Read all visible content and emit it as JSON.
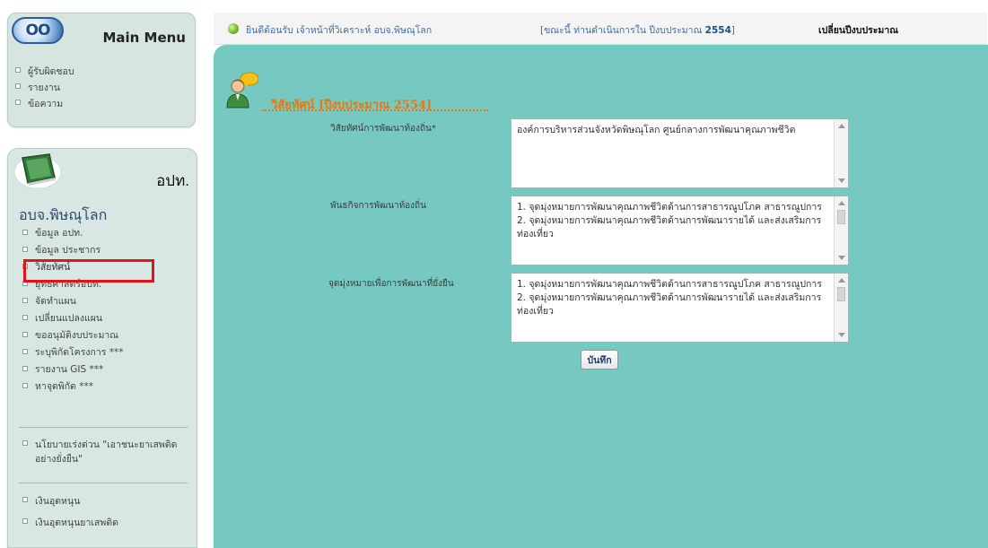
{
  "main_menu": {
    "logo_text": "OO",
    "title": "Main Menu",
    "items": [
      "ผู้รับผิดชอบ",
      "รายงาน",
      "ข้อความ"
    ]
  },
  "org": {
    "abbr": "อปท.",
    "name": "อบจ.พิษณุโลก",
    "items": [
      "ข้อมูล อปท.",
      "ข้อมูล ประชากร",
      "วิสัยทัศน์",
      "ยุทธศาสตร์อปท.",
      "จัดทำแผน",
      "เปลี่ยนแปลงแผน",
      "ขออนุมัติงบประมาณ",
      "ระบุพิกัดโครงการ ***",
      "รายงาน GIS ***",
      "หาจุดพิกัด ***"
    ],
    "active_item": "วิสัยทัศน์",
    "policy_item": "นโยบายเร่งด่วน \"เอาชนะยาเสพติดอย่างยั่งยืน\"",
    "fund_items": [
      "เงินอุดหนุน",
      "เงินอุดหนุนยาเสพติด"
    ]
  },
  "top_bar": {
    "welcome": "ยินดีต้อนรับ เจ้าหน้าที่วิเคราะห์ อบจ.พิษณุโลก",
    "year_status_prefix": "[ขณะนี้ ท่านดำเนินการใน ปีงบประมาณ",
    "year": "2554",
    "year_status_suffix": "]",
    "change_year_link": "เปลี่ยนปีงบประมาณ"
  },
  "page": {
    "title": "วิสัยทัศน์ [ปีงบประมาณ 2554]",
    "fields": [
      {
        "label": "วิสัยทัศน์การพัฒนาท้องถิ่น*",
        "value": "องค์การบริหารส่วนจังหวัดพิษณุโลก ศูนย์กลางการพัฒนาคุณภาพชีวิต"
      },
      {
        "label": "พันธกิจการพัฒนาท้องถิ่น",
        "value": "1. จุดมุ่งหมายการพัฒนาคุณภาพชีวิตด้านการสาธารณูปโภค สาธารณูปการ\n2. จุดมุ่งหมายการพัฒนาคุณภาพชีวิตด้านการพัฒนารายได้ และส่งเสริมการท่องเที่ยว"
      },
      {
        "label": "จุดมุ่งหมายเพื่อการพัฒนาที่ยั่งยืน",
        "value": "1. จุดมุ่งหมายการพัฒนาคุณภาพชีวิตด้านการสาธารณูปโภค สาธารณูปการ\n2. จุดมุ่งหมายการพัฒนาคุณภาพชีวิตด้านการพัฒนารายได้ และส่งเสริมการท่องเที่ยว"
      }
    ],
    "save_label": "บันทึก"
  },
  "colors": {
    "panel": "#76c9c0",
    "sidebar": "#d8e7e3",
    "title_orange": "#e07a1a",
    "highlight_red": "#e0141c"
  }
}
